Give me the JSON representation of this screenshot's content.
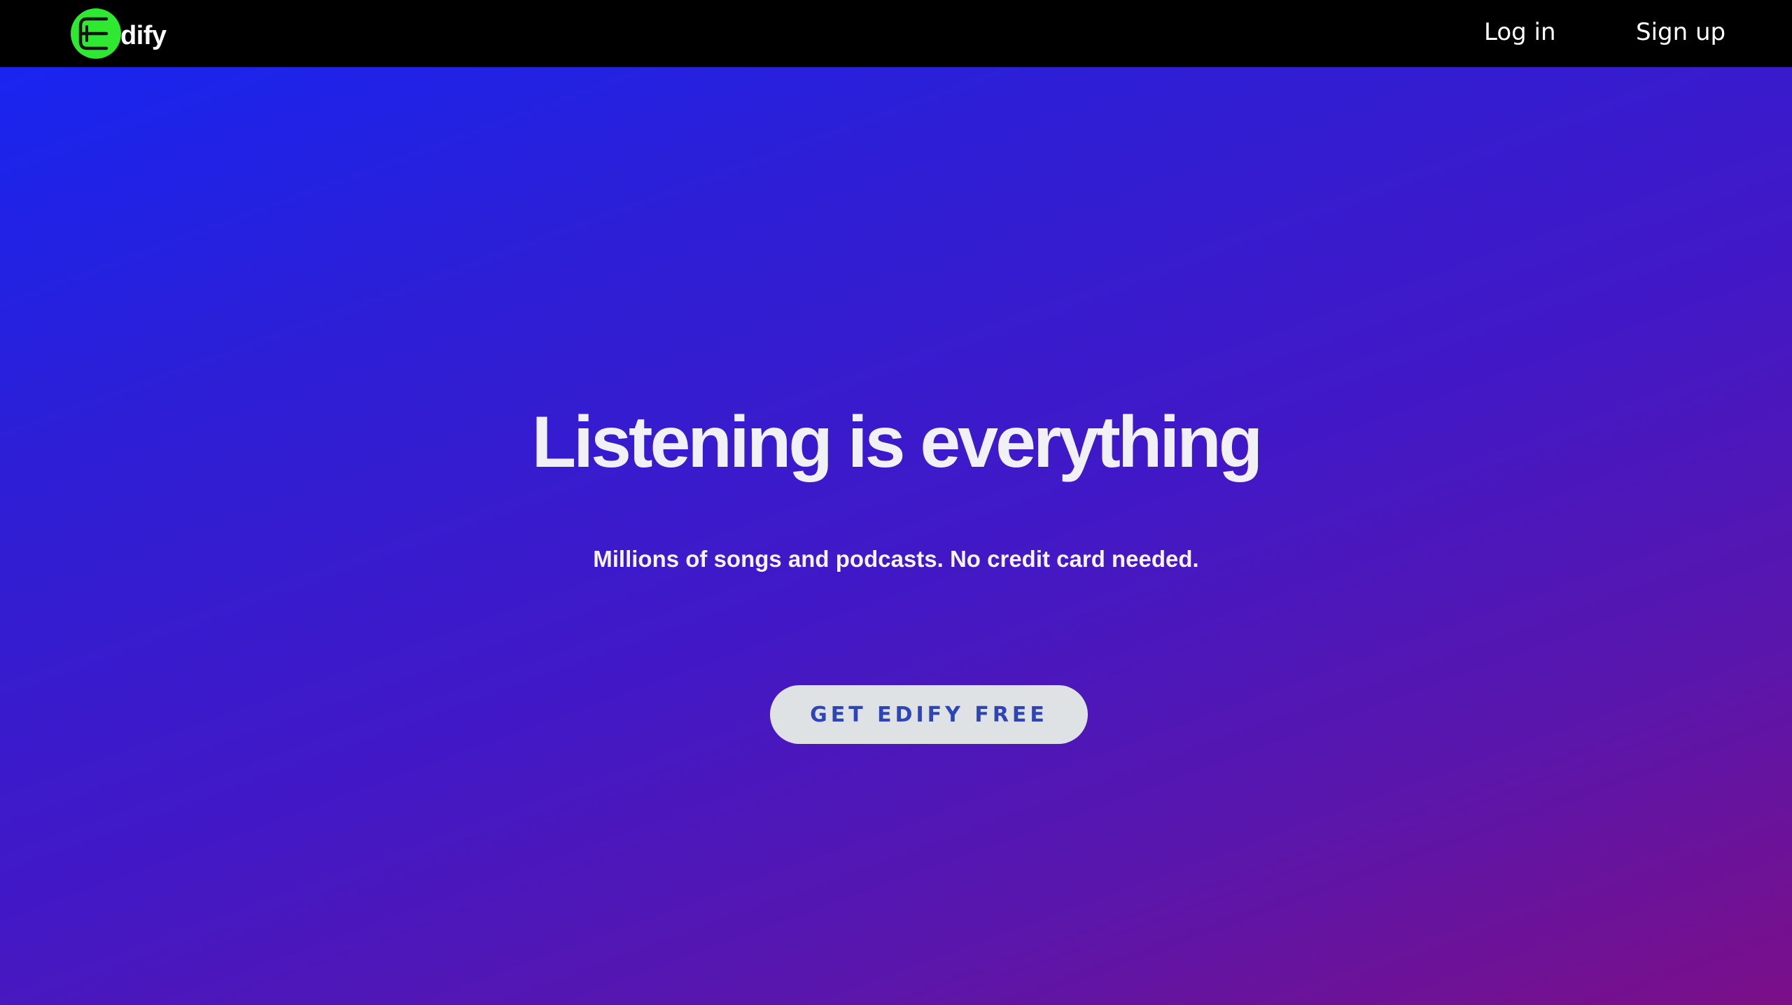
{
  "header": {
    "logo_text": "dify",
    "logo_icon": "edify-e-logo-icon",
    "login_label": "Log in",
    "signup_label": "Sign up"
  },
  "hero": {
    "title": "Listening is everything",
    "subtitle": "Millions of songs and podcasts. No credit card needed.",
    "cta_label": "GET EDIFY FREE"
  },
  "colors": {
    "navbar": "#000000",
    "logo_green": "#2ee832",
    "gradient_start": "#1526f4",
    "gradient_end": "#7b0f88",
    "cta_bg": "#dfe2e4",
    "cta_text": "#2e45b6"
  }
}
